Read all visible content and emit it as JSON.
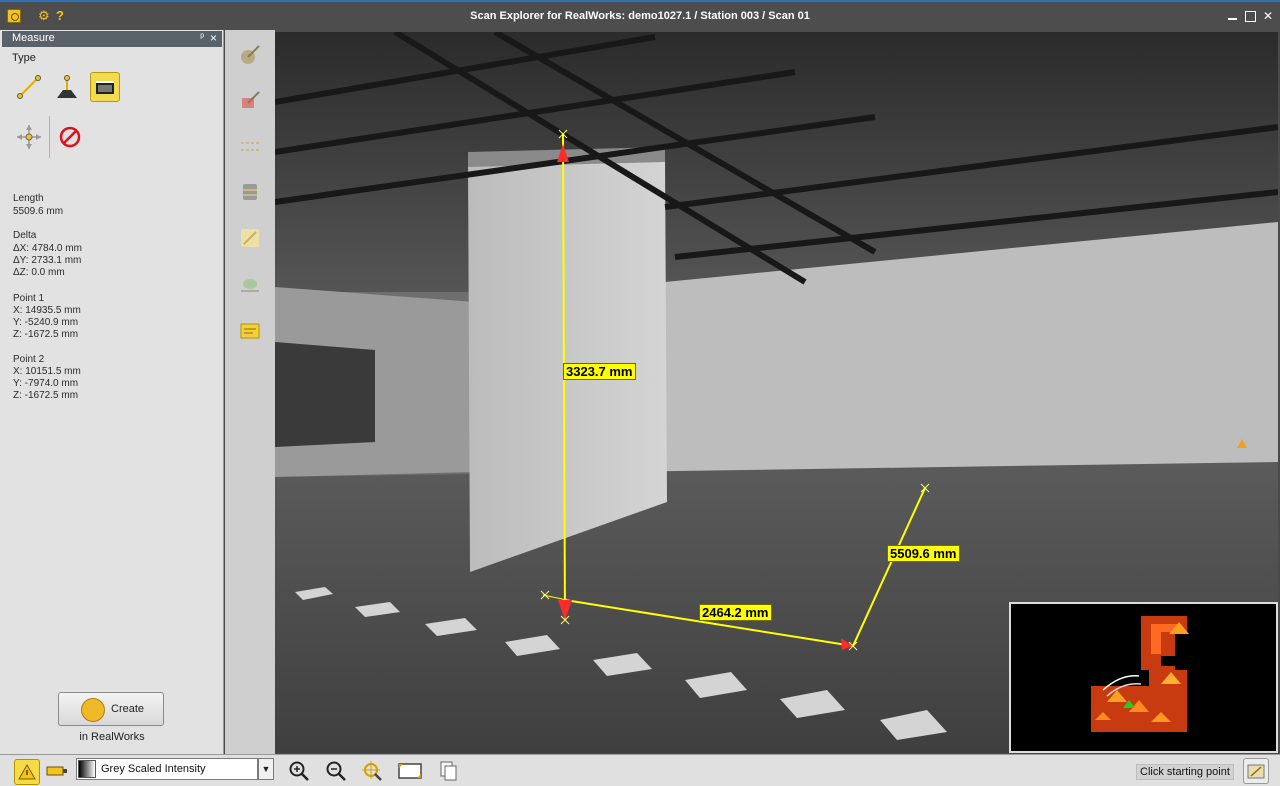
{
  "window": {
    "title": "Scan Explorer for RealWorks: demo1027.1 / Station 003 / Scan 01",
    "settings_glyph": "⚙",
    "help_glyph": "?",
    "close_glyph": "✕"
  },
  "panel": {
    "title": "Measure",
    "pin_glyph": "ᵖ",
    "close_glyph": "×",
    "type_label": "Type",
    "tools": [
      {
        "icon": "distance-measure-icon"
      },
      {
        "icon": "height-measure-icon"
      },
      {
        "icon": "plan-measure-icon",
        "selected": true
      },
      {
        "icon": "point-coordinate-icon"
      },
      {
        "icon": "no-entry-icon"
      }
    ],
    "length_label": "Length",
    "length_value": "5509.6 mm",
    "delta_label": "Delta",
    "delta_x": "ΔX: 4784.0 mm",
    "delta_y": "ΔY: 2733.1 mm",
    "delta_z": "ΔZ: 0.0 mm",
    "point1_label": "Point 1",
    "point1_x": "X: 14935.5 mm",
    "point1_y": "Y: -5240.9 mm",
    "point1_z": "Z: -1672.5 mm",
    "point2_label": "Point 2",
    "point2_x": "X: 10151.5 mm",
    "point2_y": "Y: -7974.0 mm",
    "point2_z": "Z: -1672.5 mm",
    "create_label": "Create",
    "realworks_label": "in RealWorks"
  },
  "viewport": {
    "measure_labels": [
      "3323.7 mm",
      "2464.2 mm",
      "5509.6 mm"
    ]
  },
  "bottom": {
    "color_mode": "Grey Scaled Intensity",
    "dropdown_glyph": "▼",
    "status": "Click starting point"
  },
  "colors": {
    "accent": "#f3c41f",
    "measure_line": "#ffff00",
    "marker": "#ff2a2a",
    "titlebar": "#4d4d4d"
  }
}
